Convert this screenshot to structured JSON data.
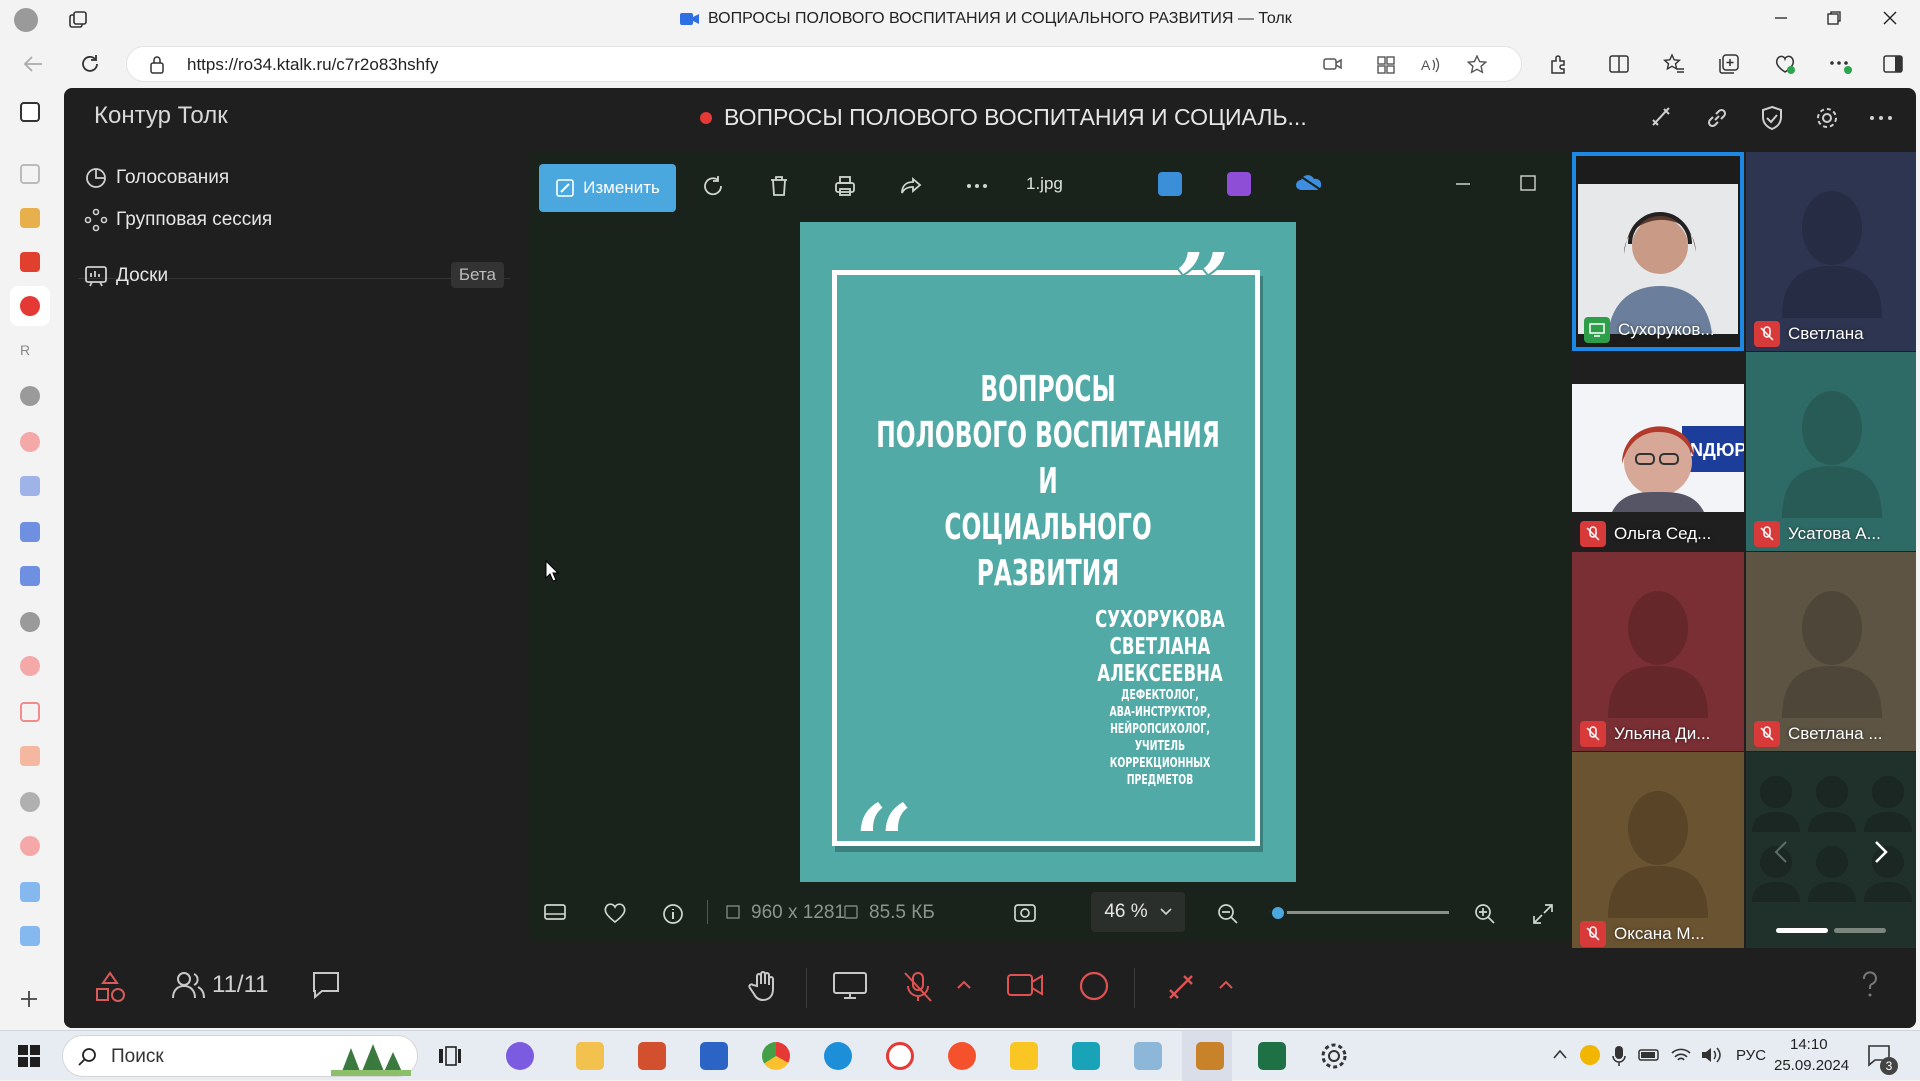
{
  "browser": {
    "window_title": "ВОПРОСЫ ПОЛОВОГО ВОСПИТАНИЯ И СОЦИАЛЬНОГО РАЗВИТИЯ — Толк",
    "url": "https://ro34.ktalk.ru/c7r2o83hshfy"
  },
  "app": {
    "brand": "Контур Толк",
    "meeting_title": "ВОПРОСЫ ПОЛОВОГО ВОСПИТАНИЯ И СОЦИАЛЬ...",
    "left_panel": {
      "items": [
        {
          "label": "Голосования"
        },
        {
          "label": "Групповая сессия"
        },
        {
          "label": "Доски",
          "badge": "Бета"
        }
      ]
    },
    "viewer": {
      "edit_label": "Изменить",
      "filename": "1.jpg",
      "dimensions": "960 x 1281",
      "filesize": "85.5 КБ",
      "zoom": "46 %",
      "zoom_fraction": 0.05
    },
    "poster": {
      "title_lines": [
        "ВОПРОСЫ",
        "ПОЛОВОГО ВОСПИТАНИЯ",
        "И",
        "СОЦИАЛЬНОГО РАЗВИТИЯ"
      ],
      "author_lines": [
        "СУХОРУКОВА",
        "СВЕТЛАНА",
        "АЛЕКСЕЕВНА"
      ],
      "job_lines": [
        "ДЕФЕКТОЛОГ,",
        "АВА-ИНСТРУКТОР,",
        "НЕЙРОПСИХОЛОГ,",
        "УЧИТЕЛЬ",
        "КОРРЕКЦИОННЫХ",
        "ПРЕДМЕТОВ"
      ],
      "bg_color": "#52aaa6"
    },
    "participants": [
      {
        "name": "Сухоруков...",
        "bg": "#1c1c1c",
        "video": true
      },
      {
        "name": "Светлана",
        "bg": "#2e3550"
      },
      {
        "name": "Ольга Сед...",
        "bg": "#f0f2f6",
        "video": true
      },
      {
        "name": "Усатова А...",
        "bg": "#2f6b66"
      },
      {
        "name": "Ульяна Ди...",
        "bg": "#7a2f34"
      },
      {
        "name": "Светлана ...",
        "bg": "#5d5443"
      },
      {
        "name": "Оксана М...",
        "bg": "#6a5330"
      }
    ],
    "participant_count": "11/11"
  },
  "taskbar": {
    "search_placeholder": "Поиск",
    "lang": "РУС",
    "time": "14:10",
    "date": "25.09.2024",
    "notifications": "3"
  }
}
